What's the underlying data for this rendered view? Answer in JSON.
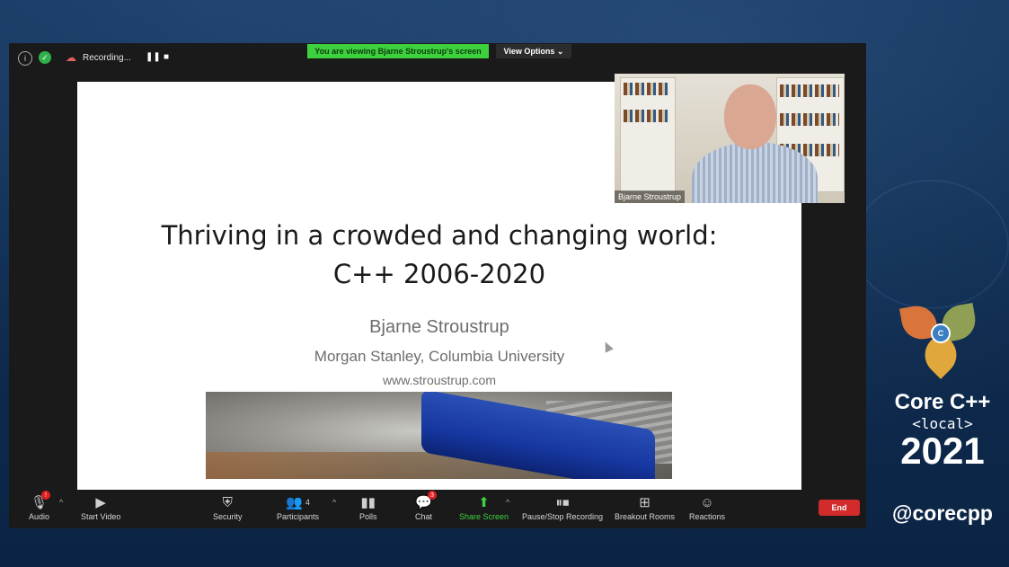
{
  "topbar": {
    "recording_label": "Recording...",
    "viewing_banner": "You are viewing Bjarne Stroustrup's screen",
    "view_options": "View Options ⌄"
  },
  "slide": {
    "title_line1": "Thriving in a crowded and changing world:",
    "title_line2": "C++ 2006-2020",
    "author": "Bjarne Stroustrup",
    "affiliation": "Morgan Stanley, Columbia University",
    "website": "www.stroustrup.com"
  },
  "video": {
    "participant_name": "Bjarne Stroustrup"
  },
  "toolbar": {
    "audio": "Audio",
    "start_video": "Start Video",
    "security": "Security",
    "participants": "Participants",
    "participants_count": "4",
    "polls": "Polls",
    "chat": "Chat",
    "chat_badge": "3",
    "share_screen": "Share Screen",
    "pause_stop_recording": "Pause/Stop Recording",
    "breakout_rooms": "Breakout Rooms",
    "reactions": "Reactions",
    "end": "End"
  },
  "branding": {
    "line1": "Core C++",
    "line2": "<local>",
    "line3": "2021",
    "handle": "@corecpp"
  },
  "colors": {
    "share_green": "#3ed13e",
    "end_red": "#d22b2b",
    "background_navy": "#0d2a4e"
  }
}
